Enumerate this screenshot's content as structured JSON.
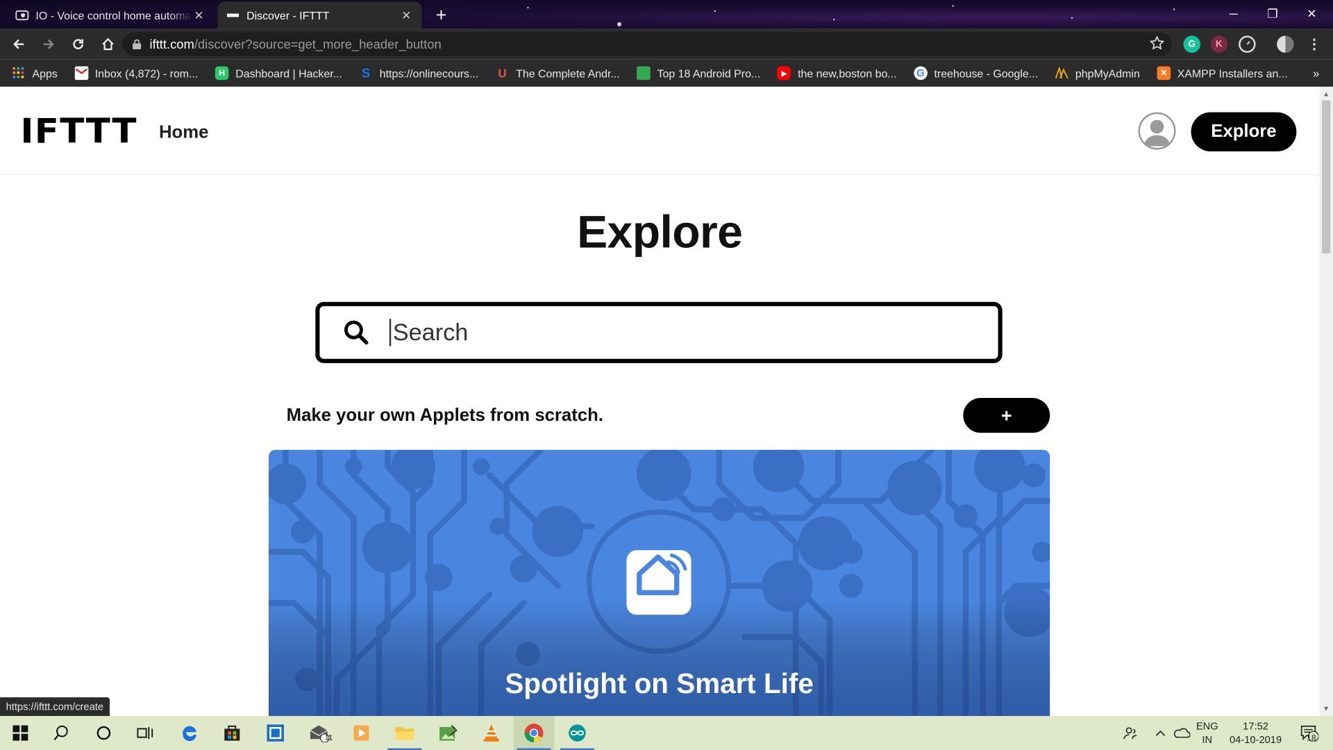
{
  "browser": {
    "tabs": [
      {
        "title": "IO - Voice control home automat",
        "active": false
      },
      {
        "title": "Discover - IFTTT",
        "active": true
      }
    ],
    "url_host": "ifttt.com",
    "url_path": "/discover?source=get_more_header_button",
    "bookmarks": [
      {
        "label": "Apps",
        "icon": "apps-grid-icon",
        "color": "#e8e8e8"
      },
      {
        "label": "Inbox (4,872) - rom...",
        "icon": "gmail-icon",
        "color": "#d93025"
      },
      {
        "label": "Dashboard | Hacker...",
        "icon": "hackerrank-icon",
        "color": "#2ec866"
      },
      {
        "label": "https://onlinecours...",
        "icon": "s-icon",
        "color": "#1a73e8"
      },
      {
        "label": "The Complete Andr...",
        "icon": "udemy-icon",
        "color": "#ec5252"
      },
      {
        "label": "Top 18 Android Pro...",
        "icon": "book-icon",
        "color": "#34a853"
      },
      {
        "label": "the new,boston bo...",
        "icon": "youtube-icon",
        "color": "#ff0000"
      },
      {
        "label": "treehouse - Google...",
        "icon": "google-icon",
        "color": "#ffffff"
      },
      {
        "label": "phpMyAdmin",
        "icon": "phpmyadmin-icon",
        "color": "#f0a30a"
      },
      {
        "label": "XAMPP Installers an...",
        "icon": "xampp-icon",
        "color": "#fb7a24"
      }
    ],
    "status_url": "https://ifttt.com/create"
  },
  "site": {
    "logo": "IFTTT",
    "nav_home": "Home",
    "explore_button": "Explore",
    "page_title": "Explore",
    "search_placeholder": "Search",
    "make_text": "Make your own Applets from scratch.",
    "plus_label": "+",
    "spotlight_title": "Spotlight on Smart Life"
  },
  "taskbar": {
    "mail_badge": "11",
    "language": "ENG",
    "region": "IN",
    "time": "17:52",
    "date": "04-10-2019",
    "notifications": "18"
  },
  "colors": {
    "spotlight_blue": "#4a86e0",
    "taskbar": "#dfe8c9",
    "browser_chrome": "#2b2b2b"
  }
}
